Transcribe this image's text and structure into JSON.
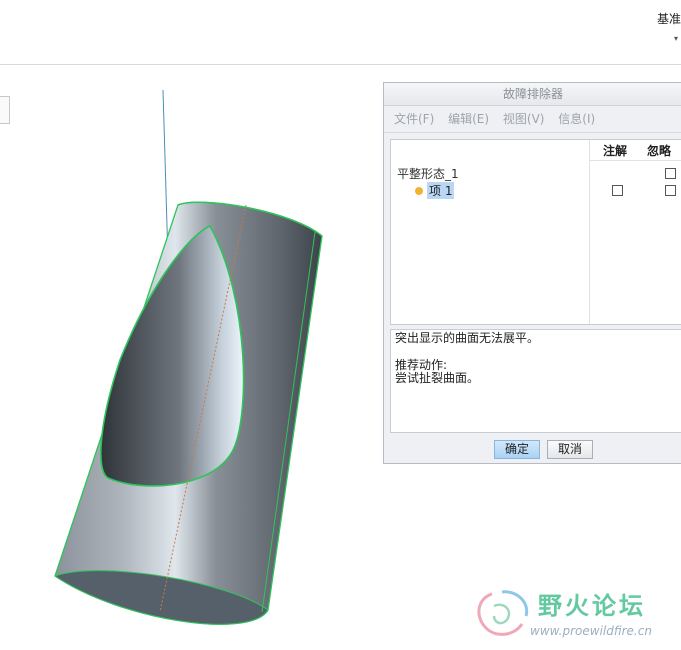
{
  "topbar": {
    "label": "基准",
    "arrow": "▾"
  },
  "dialog": {
    "title": "故障排除器",
    "menu": [
      "文件(F)",
      "编辑(E)",
      "视图(V)",
      "信息(I)"
    ],
    "columns": {
      "annotate": "注解",
      "ignore": "忽略"
    },
    "tree": {
      "root": "平整形态_1",
      "item": "项 1"
    },
    "message": {
      "line1": "突出显示的曲面无法展平。",
      "line2": "推荐动作:",
      "line3": "尝试扯裂曲面。"
    },
    "buttons": {
      "ok": "确定",
      "cancel": "取消"
    }
  },
  "watermark": {
    "title": "野火论坛",
    "url": "www.proewildfire.cn"
  },
  "colors": {
    "highlight": "#b9d7f5",
    "accent": "#a9d2f5",
    "edge": "#3fd26a",
    "model": "#8b929b"
  }
}
